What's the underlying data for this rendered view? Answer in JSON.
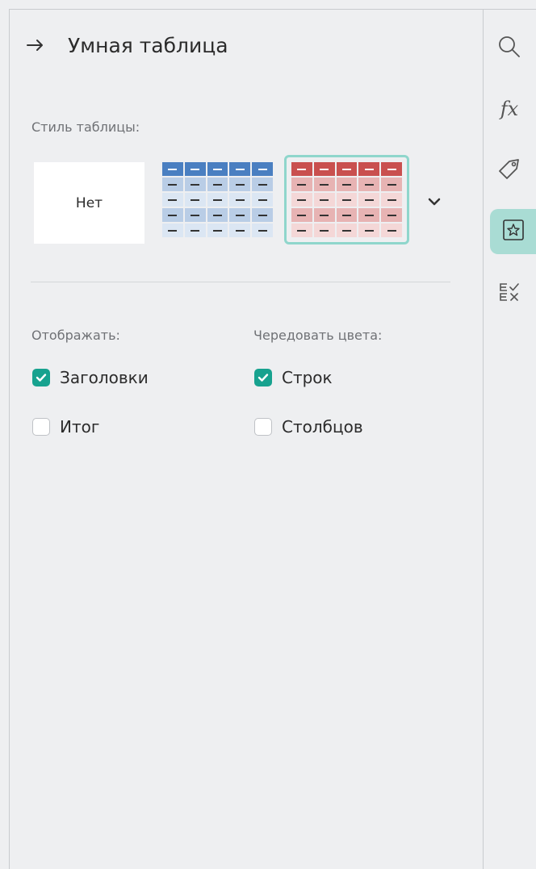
{
  "header": {
    "title": "Умная таблица"
  },
  "table_style": {
    "label": "Стиль таблицы:",
    "none_label": "Нет",
    "blue_header": "#4a7fc1",
    "blue_band": "#b9cde6",
    "blue_light": "#dbe6f3",
    "red_header": "#c9504f",
    "red_band": "#e7b3b3",
    "red_light": "#f4d7d7",
    "selected_border": "#8fd6cc"
  },
  "display": {
    "label": "Отображать:",
    "options": [
      {
        "label": "Заголовки",
        "checked": true
      },
      {
        "label": "Итог",
        "checked": false
      }
    ]
  },
  "alternate": {
    "label": "Чередовать цвета:",
    "options": [
      {
        "label": "Строк",
        "checked": true
      },
      {
        "label": "Столбцов",
        "checked": false
      }
    ]
  },
  "rail": {
    "items": [
      {
        "icon": "search-icon"
      },
      {
        "icon": "function-icon",
        "text": "fx"
      },
      {
        "icon": "tag-icon"
      },
      {
        "icon": "star-table-icon",
        "active": true
      },
      {
        "icon": "checklist-icon"
      }
    ]
  },
  "accent": "#17a28f"
}
